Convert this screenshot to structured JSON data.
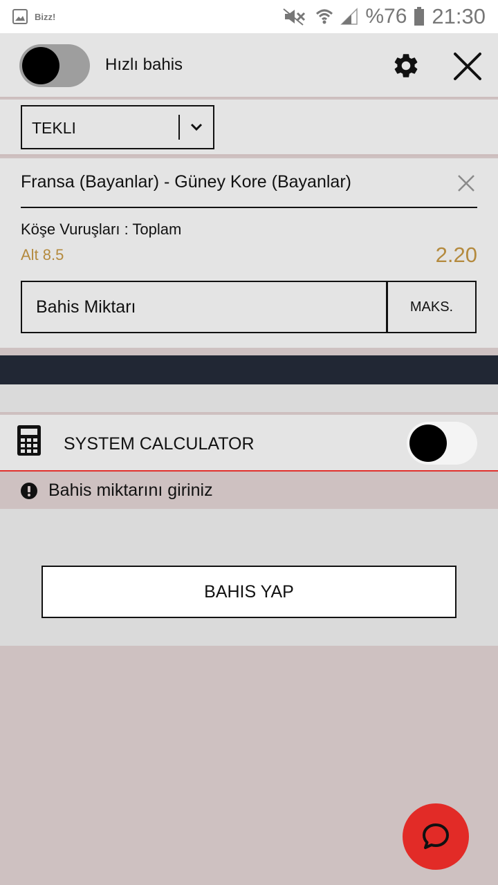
{
  "status_bar": {
    "app_name": "Bizz!",
    "battery": "%76",
    "time": "21:30"
  },
  "header": {
    "quick_bet_label": "Hızlı bahis"
  },
  "bet_type": {
    "selected": "TEKLI"
  },
  "bet": {
    "match": "Fransa (Bayanlar) - Güney Kore (Bayanlar)",
    "market": "Köşe Vuruşları : Toplam",
    "selection": "Alt 8.5",
    "odds": "2.20",
    "stake_placeholder": "Bahis Miktarı",
    "max_label": "MAKS."
  },
  "system_calculator": {
    "label": "SYSTEM CALCULATOR"
  },
  "warning": {
    "text": "Bahis miktarını giriniz"
  },
  "place_bet": {
    "label": "BAHIS YAP"
  },
  "colors": {
    "odds": "#b48a3e",
    "dark_bar": "#212734",
    "chat_fab": "#e22b27",
    "warning_line": "#e0302c"
  }
}
